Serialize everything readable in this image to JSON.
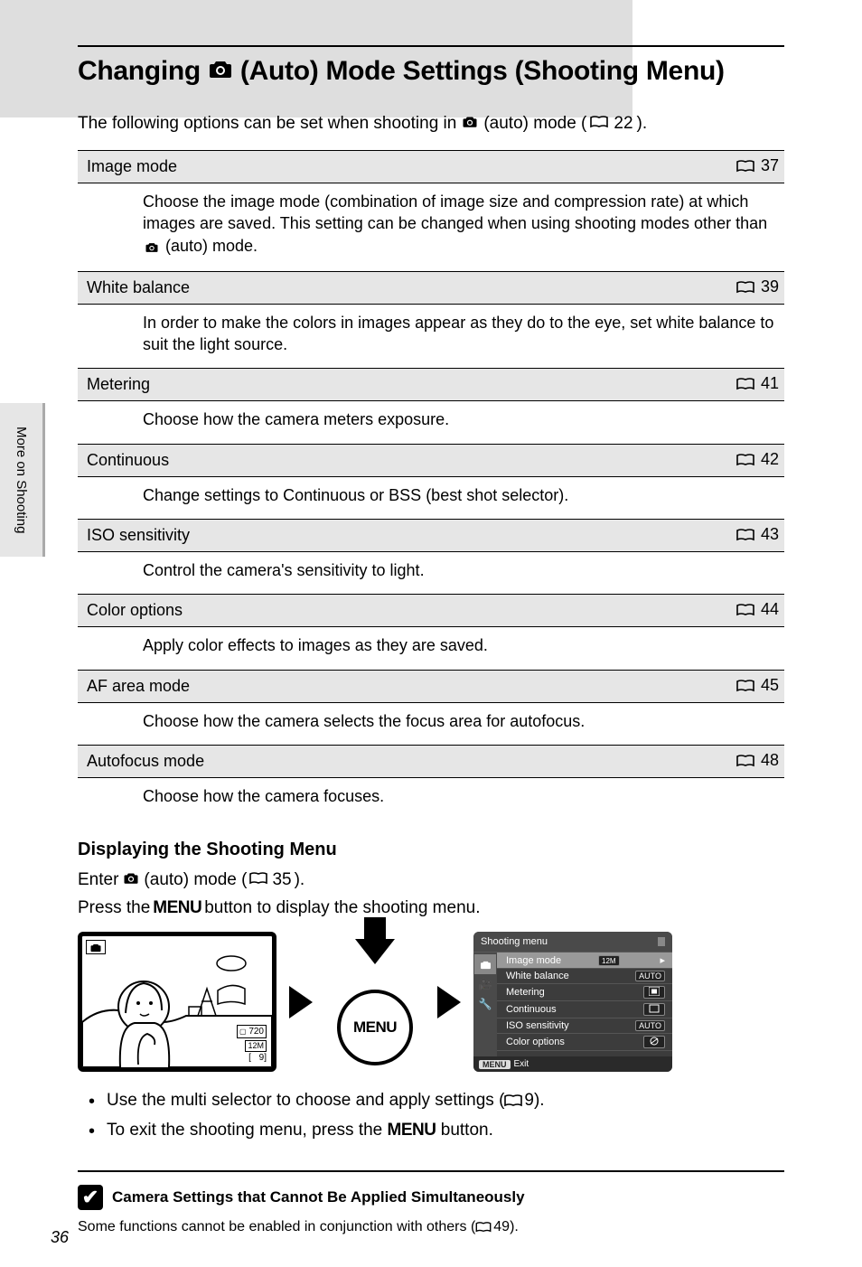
{
  "title_prefix": "Changing",
  "title_suffix": "(Auto) Mode Settings (Shooting Menu)",
  "intro_pre": "The following options can be set when shooting in",
  "intro_mid": "(auto) mode (",
  "intro_page": "22",
  "intro_end": ").",
  "options": [
    {
      "name": "Image mode",
      "page": "37",
      "desc_pre": "Choose the image mode (combination of image size and compression rate) at which images are saved. This setting can be changed when using shooting modes other than",
      "desc_post": "(auto) mode."
    },
    {
      "name": "White balance",
      "page": "39",
      "desc": "In order to make the colors in images appear as they do to the eye, set white balance to suit the light source."
    },
    {
      "name": "Metering",
      "page": "41",
      "desc": "Choose how the camera meters exposure."
    },
    {
      "name": "Continuous",
      "page": "42",
      "desc": "Change settings to Continuous or BSS (best shot selector)."
    },
    {
      "name": "ISO sensitivity",
      "page": "43",
      "desc": "Control the camera's sensitivity to light."
    },
    {
      "name": "Color options",
      "page": "44",
      "desc": "Apply color effects to images as they are saved."
    },
    {
      "name": "AF area mode",
      "page": "45",
      "desc": "Choose how the camera selects the focus area for autofocus."
    },
    {
      "name": "Autofocus mode",
      "page": "48",
      "desc": "Choose how the camera focuses."
    }
  ],
  "sub_heading": "Displaying the Shooting Menu",
  "enter_pre": "Enter",
  "enter_mid": "(auto) mode (",
  "enter_page": "35",
  "enter_end": ").",
  "press_pre": "Press the",
  "press_menu": "MENU",
  "press_post": "button to display the shooting menu.",
  "lcd_counter": "9",
  "lcd_res": "720",
  "menu_button_label": "MENU",
  "menu_screen": {
    "title": "Shooting menu",
    "items": [
      {
        "label": "Image mode",
        "value_icon": "12M"
      },
      {
        "label": "White balance",
        "value": "AUTO"
      },
      {
        "label": "Metering",
        "value_icon": "matrix"
      },
      {
        "label": "Continuous",
        "value_icon": "single"
      },
      {
        "label": "ISO sensitivity",
        "value": "AUTO"
      },
      {
        "label": "Color options",
        "value_icon": "standard"
      }
    ],
    "exit_label": "Exit",
    "exit_btn": "MENU"
  },
  "bullet1_pre": "Use the multi selector to choose and apply settings (",
  "bullet1_page": "9",
  "bullet1_end": ").",
  "bullet2_pre": "To exit the shooting menu, press the",
  "bullet2_menu": "MENU",
  "bullet2_end": "button.",
  "note_title": "Camera Settings that Cannot Be Applied Simultaneously",
  "note_body_pre": "Some functions cannot be enabled in conjunction with others (",
  "note_body_page": "49",
  "note_body_end": ").",
  "side_tab": "More on Shooting",
  "page_number": "36"
}
